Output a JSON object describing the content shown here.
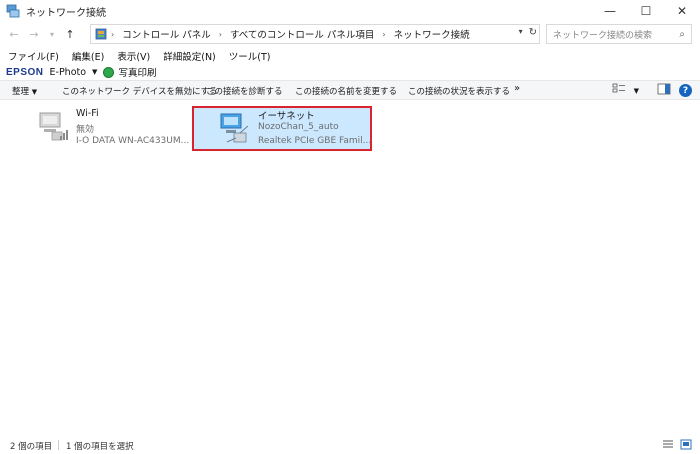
{
  "window": {
    "title": "ネットワーク接続",
    "icon": "network-connections-icon",
    "minimize": "—",
    "maximize": "☐",
    "close": "✕"
  },
  "address": {
    "back": "←",
    "forward": "→",
    "up": "↑",
    "crumbs": [
      "コントロール パネル",
      "すべてのコントロール パネル項目",
      "ネットワーク接続"
    ],
    "search_placeholder": "ネットワーク接続の検索"
  },
  "menu": [
    "ファイル(F)",
    "編集(E)",
    "表示(V)",
    "詳細設定(N)",
    "ツール(T)"
  ],
  "epson": {
    "brand": "EPSON",
    "app": "E-Photo",
    "print": "写真印刷",
    "brand_color": "#1b3a8c"
  },
  "commands": {
    "organize": "整理",
    "disable": "このネットワーク デバイスを無効にする",
    "diagnose": "この接続を診断する",
    "rename": "この接続の名前を変更する",
    "status": "この接続の状況を表示する",
    "more": "»"
  },
  "connections": [
    {
      "name": "Wi-Fi",
      "status": "無効",
      "device": "I-O DATA WN-AC433UM...",
      "selected": false
    },
    {
      "name": "イーサネット",
      "status": "NozoChan_5_auto",
      "device": "Realtek PCIe GBE Famil...",
      "selected": true
    }
  ],
  "status_bar": {
    "count": "2 個の項目",
    "selected": "1 個の項目を選択"
  },
  "colors": {
    "selection_fill": "#cce8ff",
    "selection_border": "#d9232e",
    "command_bar": "#f5f6f8"
  }
}
